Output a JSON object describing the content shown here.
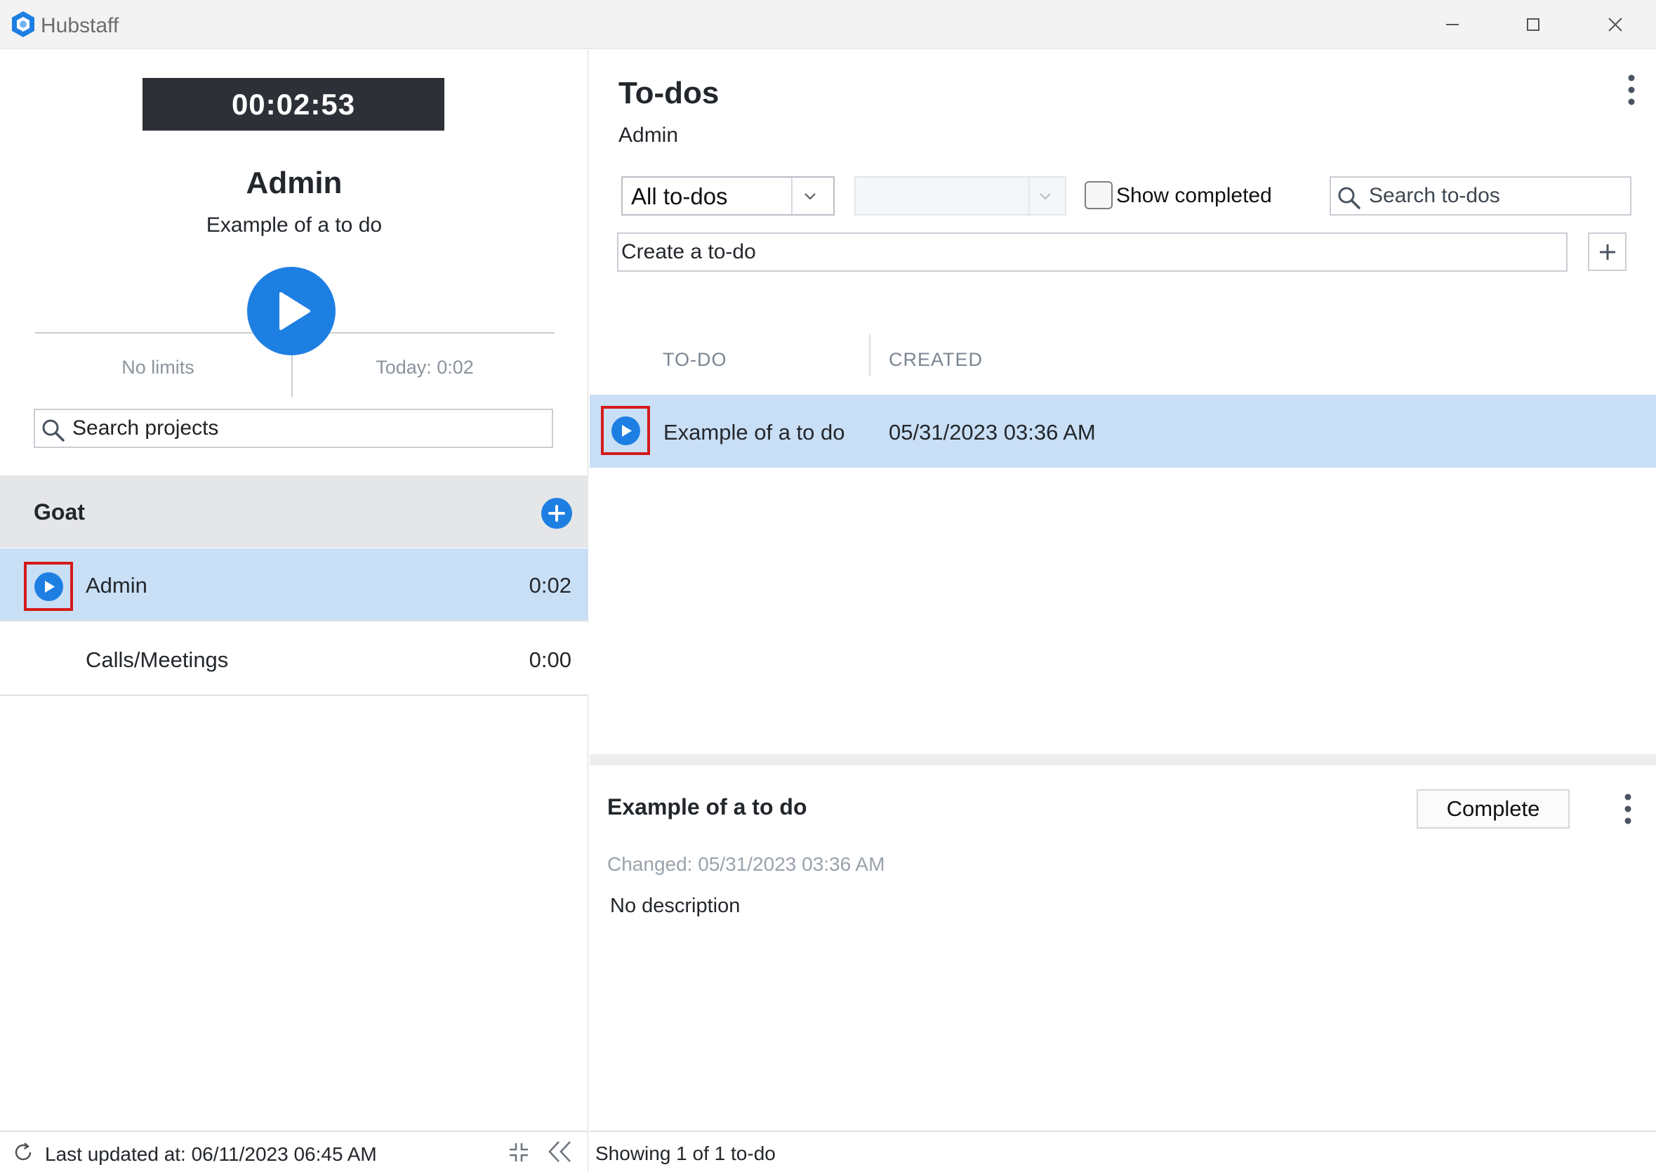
{
  "window": {
    "app_title": "Hubstaff",
    "icons": {
      "logo": "hubstaff-logo-icon",
      "minimize": "minimize-icon",
      "maximize": "maximize-icon",
      "close": "close-icon"
    }
  },
  "left": {
    "timer": "00:02:53",
    "current_project": "Admin",
    "current_todo": "Example of a to do",
    "limits": "No limits",
    "today": "Today: 0:02",
    "search_placeholder": "Search projects",
    "group": {
      "name": "Goat",
      "projects": [
        {
          "name": "Admin",
          "time": "0:02",
          "selected": true
        },
        {
          "name": "Calls/Meetings",
          "time": "0:00",
          "selected": false
        }
      ]
    },
    "footer": {
      "last_updated": "Last updated at: 06/11/2023 06:45 AM"
    }
  },
  "right": {
    "title": "To-dos",
    "subtitle": "Admin",
    "filter": {
      "selected": "All to-dos"
    },
    "show_completed_label": "Show completed",
    "show_completed_checked": false,
    "search_placeholder": "Search to-dos",
    "create_placeholder": "Create a to-do",
    "table": {
      "headers": [
        "TO-DO",
        "CREATED"
      ],
      "rows": [
        {
          "name": "Example of a to do",
          "created": "05/31/2023 03:36 AM"
        }
      ]
    },
    "detail": {
      "title": "Example of a to do",
      "complete_label": "Complete",
      "changed": "Changed: 05/31/2023 03:36 AM",
      "description": "No description"
    },
    "footer": {
      "showing": "Showing 1 of 1 to-do"
    }
  },
  "colors": {
    "accent": "#1e7fe3",
    "selection": "#c9dff6",
    "timer_bg": "#2d3137",
    "highlight_box": "#d41b1b"
  }
}
